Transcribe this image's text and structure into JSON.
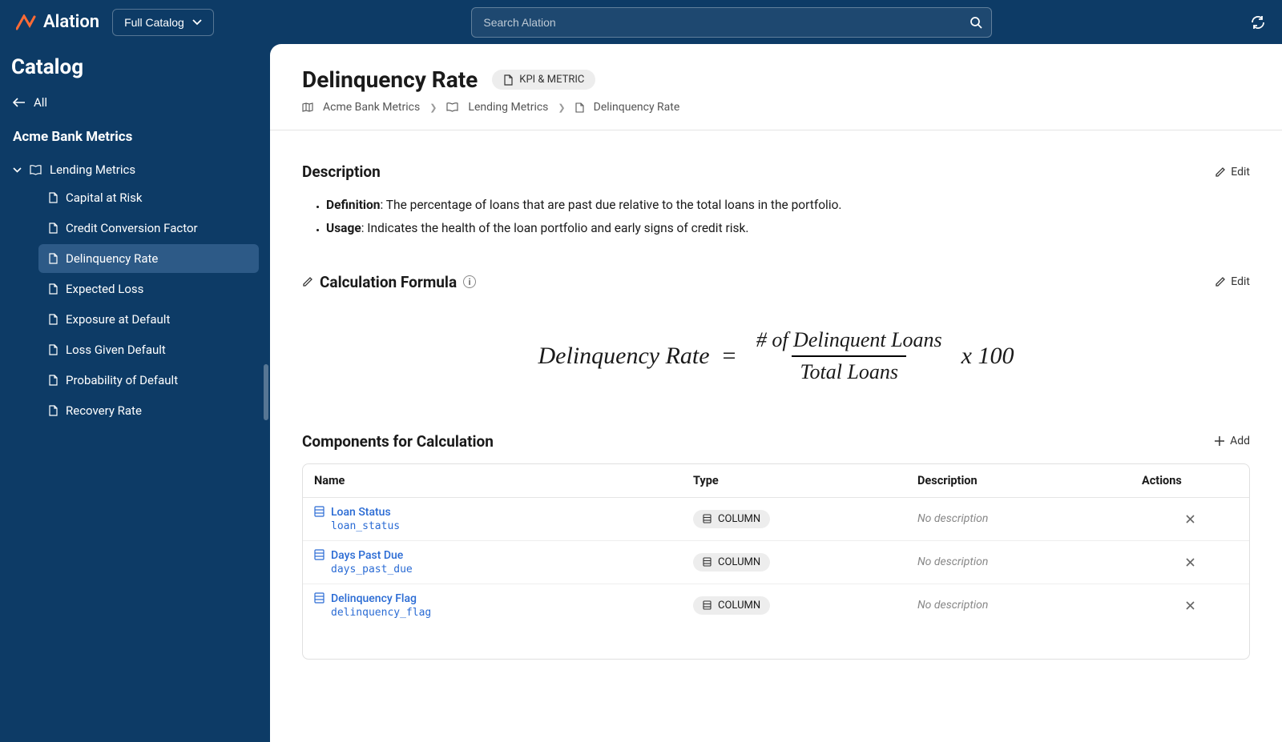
{
  "topbar": {
    "brand": "Alation",
    "full_catalog": "Full Catalog",
    "search_placeholder": "Search Alation"
  },
  "sidebar": {
    "title": "Catalog",
    "back_label": "All",
    "section_title": "Acme Bank Metrics",
    "parent": "Lending Metrics",
    "items": [
      "Capital at Risk",
      "Credit Conversion Factor",
      "Delinquency Rate",
      "Expected Loss",
      "Exposure at Default",
      "Loss Given Default",
      "Probability of Default",
      "Recovery Rate"
    ],
    "active_index": 2
  },
  "page": {
    "title": "Delinquency Rate",
    "tag": "KPI & METRIC",
    "breadcrumbs": [
      "Acme Bank Metrics",
      "Lending Metrics",
      "Delinquency Rate"
    ]
  },
  "description": {
    "heading": "Description",
    "edit": "Edit",
    "bullets": [
      {
        "label": "Definition",
        "text": ": The percentage of loans that are past due relative to the total loans in the portfolio."
      },
      {
        "label": "Usage",
        "text": ": Indicates the health of the loan portfolio and early signs of credit risk."
      }
    ]
  },
  "formula": {
    "heading": "Calculation Formula",
    "edit": "Edit",
    "lhs": "Delinquency Rate",
    "eq": "=",
    "numerator": "# of Delinquent Loans",
    "denominator": "Total Loans",
    "tail": "x 100"
  },
  "components": {
    "heading": "Components for Calculation",
    "add": "Add",
    "columns": [
      "Name",
      "Type",
      "Description",
      "Actions"
    ],
    "rows": [
      {
        "label": "Loan Status",
        "tech": "loan_status",
        "type": "COLUMN",
        "desc": "No description"
      },
      {
        "label": "Days Past Due",
        "tech": "days_past_due",
        "type": "COLUMN",
        "desc": "No description"
      },
      {
        "label": "Delinquency Flag",
        "tech": "delinquency_flag",
        "type": "COLUMN",
        "desc": "No description"
      }
    ]
  }
}
